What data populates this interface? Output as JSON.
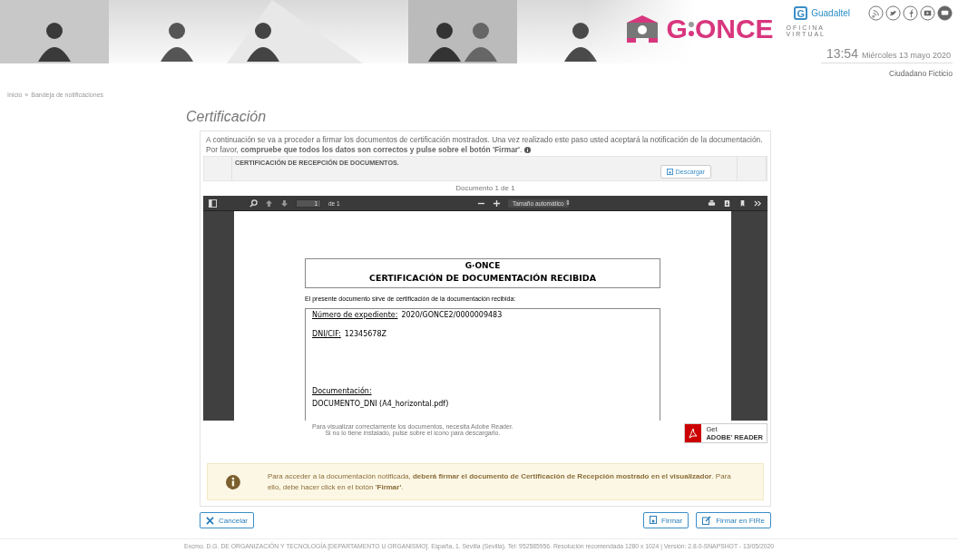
{
  "header": {
    "brand_initial": "G",
    "brand_rest": "ONCE",
    "brand_subtitle": [
      "OFICINA",
      "VIRTUAL"
    ],
    "partner_initial": "G",
    "partner_link": "Guadaltel",
    "time": "13:54",
    "date": "Miércoles 13 mayo 2020",
    "user": "Ciudadano Ficticio"
  },
  "breadcrumb": {
    "items": [
      "Inicio",
      "Bandeja de notificaciones"
    ],
    "separator": "»"
  },
  "title": "Certificación",
  "intro_lines": [
    "A continuación se va a proceder a firmar los documentos de certificación mostrados. Una vez realizado este paso usted aceptará la notificación de la documentación.",
    "Por favor, **compruebe que todos los datos son correctos y pulse sobre el botón 'Firmar'**."
  ],
  "documents_table": {
    "rows": [
      {
        "column_2": "CERTIFICACIÓN DE RECEPCIÓN DE DOCUMENTOS.",
        "action": "Descargar"
      }
    ]
  },
  "document_counter": "Documento 1 de 1",
  "viewer": {
    "page": "1",
    "page_total": "de 1",
    "zoom": "Tamaño automático",
    "zoom_caret": "⇕",
    "document": {
      "brand": "G·ONCE",
      "heading": "CERTIFICACIÓN DE DOCUMENTACIÓN RECIBIDA",
      "intro": "El presente documento sirve de certificación de la documentación recibida:",
      "fields": [
        {
          "label": "Número de expediente:",
          "value": "2020/GONCE2/0000009483"
        },
        {
          "label": "DNI/CIF:",
          "value": "12345678Z"
        }
      ],
      "section": "Documentación:",
      "files": [
        "DOCUMENTO_DNI (A4_horizontal.pdf)"
      ]
    }
  },
  "reader_note": [
    "Para visualizar correctamente los documentos, necesita Adobe Reader.",
    "Si no lo tiene instalado, pulse sobre el icono para descargarlo."
  ],
  "reader_badge": {
    "top": "Get",
    "bottom": "ADOBE' READER"
  },
  "alert": "Para acceder a la documentación notificada, **deberá firmar el documento de Certificación de Recepción mostrado en el visualizador**. Para ello, debe hacer click en el botón **'Firmar'**.",
  "buttons": [
    {
      "label": "Cancelar",
      "kind": "cancel"
    },
    {
      "label": "Firmar",
      "kind": "sign"
    },
    {
      "label": "Firmar en FIRe",
      "kind": "sign-fire"
    }
  ],
  "footer": "Excmo. D.G. DE ORGANIZACIÓN Y TECNOLOGÍA [DEPARTAMENTO U ORGANISMO]. España, 1. Sevilla (Sevilla). Tel: 952585956. Resolución recomendada 1280 x 1024 | Versión: 2.8.0-SNAPSHOT - 13/05/2020"
}
